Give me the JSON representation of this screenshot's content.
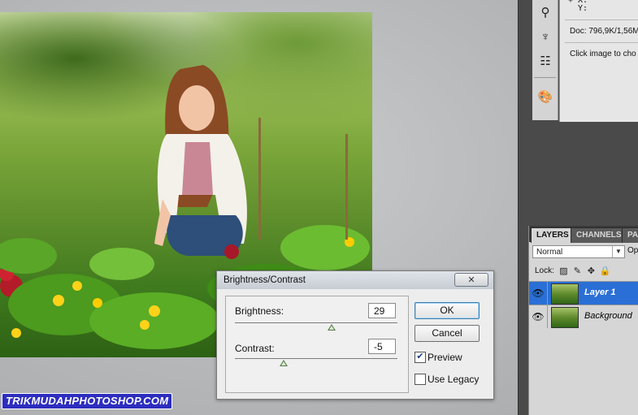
{
  "canvas": {
    "image_alt": "girl in garden"
  },
  "info": {
    "coords": "+ X:\n  Y:",
    "doc": "Doc: 796,9K/1,56M",
    "hint": "Click image to cho"
  },
  "tools": {
    "icons": [
      "brush-preset-icon",
      "clone-source-icon",
      "tool-presets-icon",
      "color-palette-icon"
    ]
  },
  "layers_panel": {
    "tabs": [
      "LAYERS",
      "CHANNELS",
      "PA"
    ],
    "blend_mode": "Normal",
    "opacity_label": "Op",
    "lock_label": "Lock:",
    "layers": [
      {
        "name": "Layer 1",
        "selected": true
      },
      {
        "name": "Background",
        "selected": false
      }
    ]
  },
  "dialog": {
    "title": "Brightness/Contrast",
    "brightness_label": "Brightness:",
    "brightness_value": "29",
    "brightness_level": 29,
    "contrast_label": "Contrast:",
    "contrast_value": "-5",
    "contrast_level": -5,
    "ok_label": "OK",
    "cancel_label": "Cancel",
    "preview_label": "Preview",
    "preview_checked": true,
    "legacy_label": "Use Legacy",
    "legacy_checked": false,
    "close_glyph": "✕"
  },
  "watermark": {
    "text": "TRIKMUDAHPHOTOSHOP.COM"
  },
  "colors": {
    "selected_layer": "#2a6fd6",
    "watermark_bg": "#2d2dbf"
  }
}
